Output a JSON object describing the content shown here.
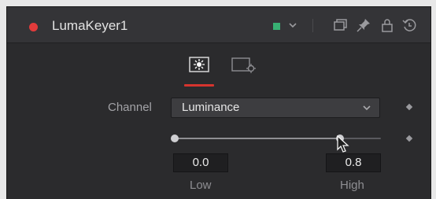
{
  "header": {
    "title": "LumaKeyer1",
    "color_swatch": "#38b073",
    "status_dot_color": "#e23b3b",
    "icons": [
      "color-menu-chevron-icon",
      "window-icon",
      "pin-icon",
      "lock-icon",
      "reset-icon"
    ]
  },
  "tabs": [
    {
      "name": "controls",
      "icon": "controls-tab-icon",
      "active": true
    },
    {
      "name": "settings",
      "icon": "settings-tab-icon",
      "active": false
    }
  ],
  "channel": {
    "label": "Channel",
    "value": "Luminance"
  },
  "range": {
    "low": {
      "label": "Low",
      "value": "0.0"
    },
    "high": {
      "label": "High",
      "value": "0.8"
    },
    "low_fraction": 0.0,
    "high_fraction": 0.8
  },
  "colors": {
    "accent": "#d6342e",
    "panel_bg": "#2b2b2d"
  }
}
